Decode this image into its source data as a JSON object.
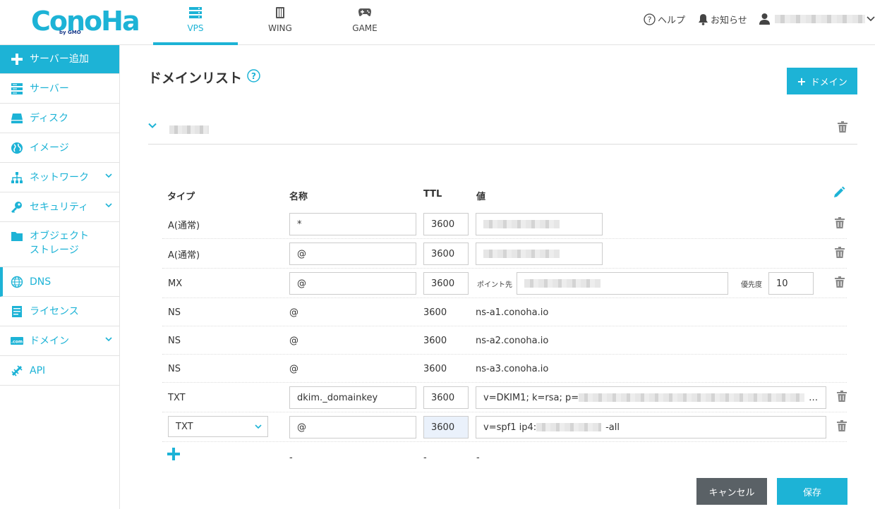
{
  "header": {
    "logo_text": "ConoHa",
    "logo_sub": "by GMO",
    "tabs": [
      {
        "label": "VPS",
        "icon": "server-stack-icon",
        "active": true
      },
      {
        "label": "WING",
        "icon": "wing-server-icon",
        "active": false
      },
      {
        "label": "GAME",
        "icon": "gamepad-icon",
        "active": false
      }
    ],
    "help_label": "ヘルプ",
    "notice_label": "お知らせ"
  },
  "sidebar": {
    "items": [
      {
        "label": "サーバー追加",
        "icon": "plus-icon"
      },
      {
        "label": "サーバー",
        "icon": "server-icon"
      },
      {
        "label": "ディスク",
        "icon": "disk-icon"
      },
      {
        "label": "イメージ",
        "icon": "globe-image-icon"
      },
      {
        "label": "ネットワーク",
        "icon": "network-icon"
      },
      {
        "label": "セキュリティ",
        "icon": "key-icon"
      },
      {
        "label": "オブジェクト",
        "label2": "ストレージ",
        "icon": "folder-icon"
      },
      {
        "label": "DNS",
        "icon": "globe-icon"
      },
      {
        "label": "ライセンス",
        "icon": "license-icon"
      },
      {
        "label": "ドメイン",
        "icon": "domain-icon"
      },
      {
        "label": "API",
        "icon": "api-icon"
      }
    ]
  },
  "main": {
    "title": "ドメインリスト",
    "add_domain_label": "ドメイン",
    "columns": {
      "type": "タイプ",
      "name": "名称",
      "ttl": "TTL",
      "value": "値"
    },
    "records": [
      {
        "type": "A(通常)",
        "name": "*",
        "ttl": "3600"
      },
      {
        "type": "A(通常)",
        "name": "@",
        "ttl": "3600"
      },
      {
        "type": "MX",
        "name": "@",
        "ttl": "3600",
        "point_label": "ポイント先",
        "priority_label": "優先度",
        "priority": "10"
      },
      {
        "type": "NS",
        "name": "@",
        "ttl": "3600",
        "value": "ns-a1.conoha.io"
      },
      {
        "type": "NS",
        "name": "@",
        "ttl": "3600",
        "value": "ns-a2.conoha.io"
      },
      {
        "type": "NS",
        "name": "@",
        "ttl": "3600",
        "value": "ns-a3.conoha.io"
      },
      {
        "type": "TXT",
        "name": "dkim._domainkey",
        "ttl": "3600",
        "value_prefix": "v=DKIM1; k=rsa; p=",
        "value_suffix": "…"
      },
      {
        "type": "TXT",
        "name": "@",
        "ttl": "3600",
        "value_prefix": "v=spf1 ip4:",
        "value_suffix": "-all"
      }
    ],
    "new_row": {
      "name": "-",
      "ttl": "-",
      "value": "-"
    },
    "cancel_label": "キャンセル",
    "save_label": "保存"
  },
  "colors": {
    "accent": "#1db3d6",
    "cancel": "#5a6166"
  }
}
